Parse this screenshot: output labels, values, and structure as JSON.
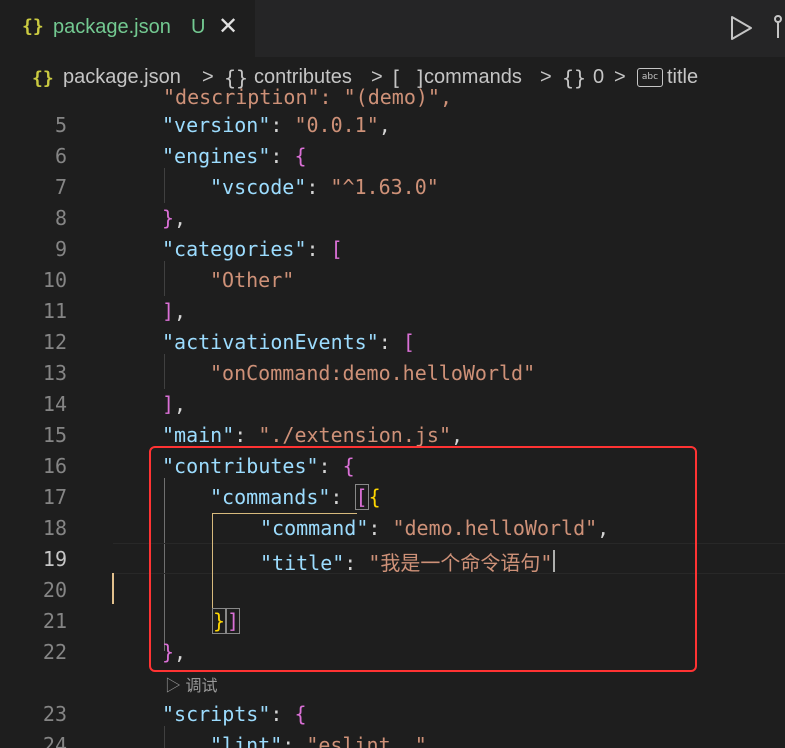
{
  "tab": {
    "icon": "{}",
    "label": "package.json",
    "status": "U",
    "close": "✕"
  },
  "breadcrumb": {
    "items": [
      {
        "icon": "{}",
        "label": "package.json"
      },
      {
        "icon": "{}",
        "label": "contributes"
      },
      {
        "icon": "[ ]",
        "label": "commands"
      },
      {
        "icon": "{}",
        "label": "0"
      },
      {
        "icon": "abc",
        "label": "title"
      }
    ],
    "separator": ">"
  },
  "editor": {
    "partial_line": "\"description\": \"(demo)\",",
    "lines": [
      {
        "num": "5",
        "text": "\"version\": \"0.0.1\","
      },
      {
        "num": "6",
        "text": "\"engines\": {"
      },
      {
        "num": "7",
        "text": "\"vscode\": \"^1.63.0\""
      },
      {
        "num": "8",
        "text": "},"
      },
      {
        "num": "9",
        "text": "\"categories\": ["
      },
      {
        "num": "10",
        "text": "\"Other\""
      },
      {
        "num": "11",
        "text": "],"
      },
      {
        "num": "12",
        "text": "\"activationEvents\": ["
      },
      {
        "num": "13",
        "text": "\"onCommand:demo.helloWorld\""
      },
      {
        "num": "14",
        "text": "],"
      },
      {
        "num": "15",
        "text": "\"main\": \"./extension.js\","
      },
      {
        "num": "16",
        "text": "\"contributes\": {"
      },
      {
        "num": "17",
        "text": "\"commands\": [{"
      },
      {
        "num": "18",
        "text": "\"command\": \"demo.helloWorld\","
      },
      {
        "num": "19",
        "text": "\"title\": \"我是一个命令语句\""
      },
      {
        "num": "20",
        "text": ""
      },
      {
        "num": "21",
        "text": "}]"
      },
      {
        "num": "22",
        "text": "},"
      },
      {
        "num": "23",
        "text": "\"scripts\": {"
      },
      {
        "num": "24",
        "text": "\"lint\": \"eslint .\","
      }
    ],
    "code_lens": "调试",
    "active_line": "19",
    "cursor_position": "Ln 19"
  },
  "colors": {
    "key": "#9cdcfe",
    "string": "#ce9178",
    "bracket1": "#da70d6",
    "bracket2": "#ffd700",
    "annotation_box": "#ff3333"
  }
}
